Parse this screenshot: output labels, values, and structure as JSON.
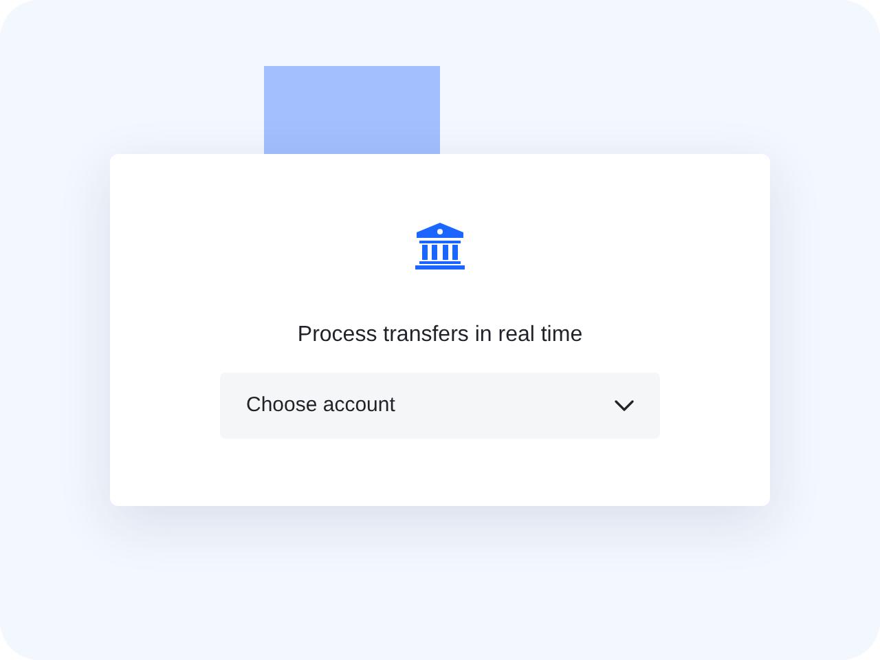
{
  "card": {
    "heading": "Process transfers in real time",
    "account_select": {
      "value": "Choose account"
    }
  }
}
